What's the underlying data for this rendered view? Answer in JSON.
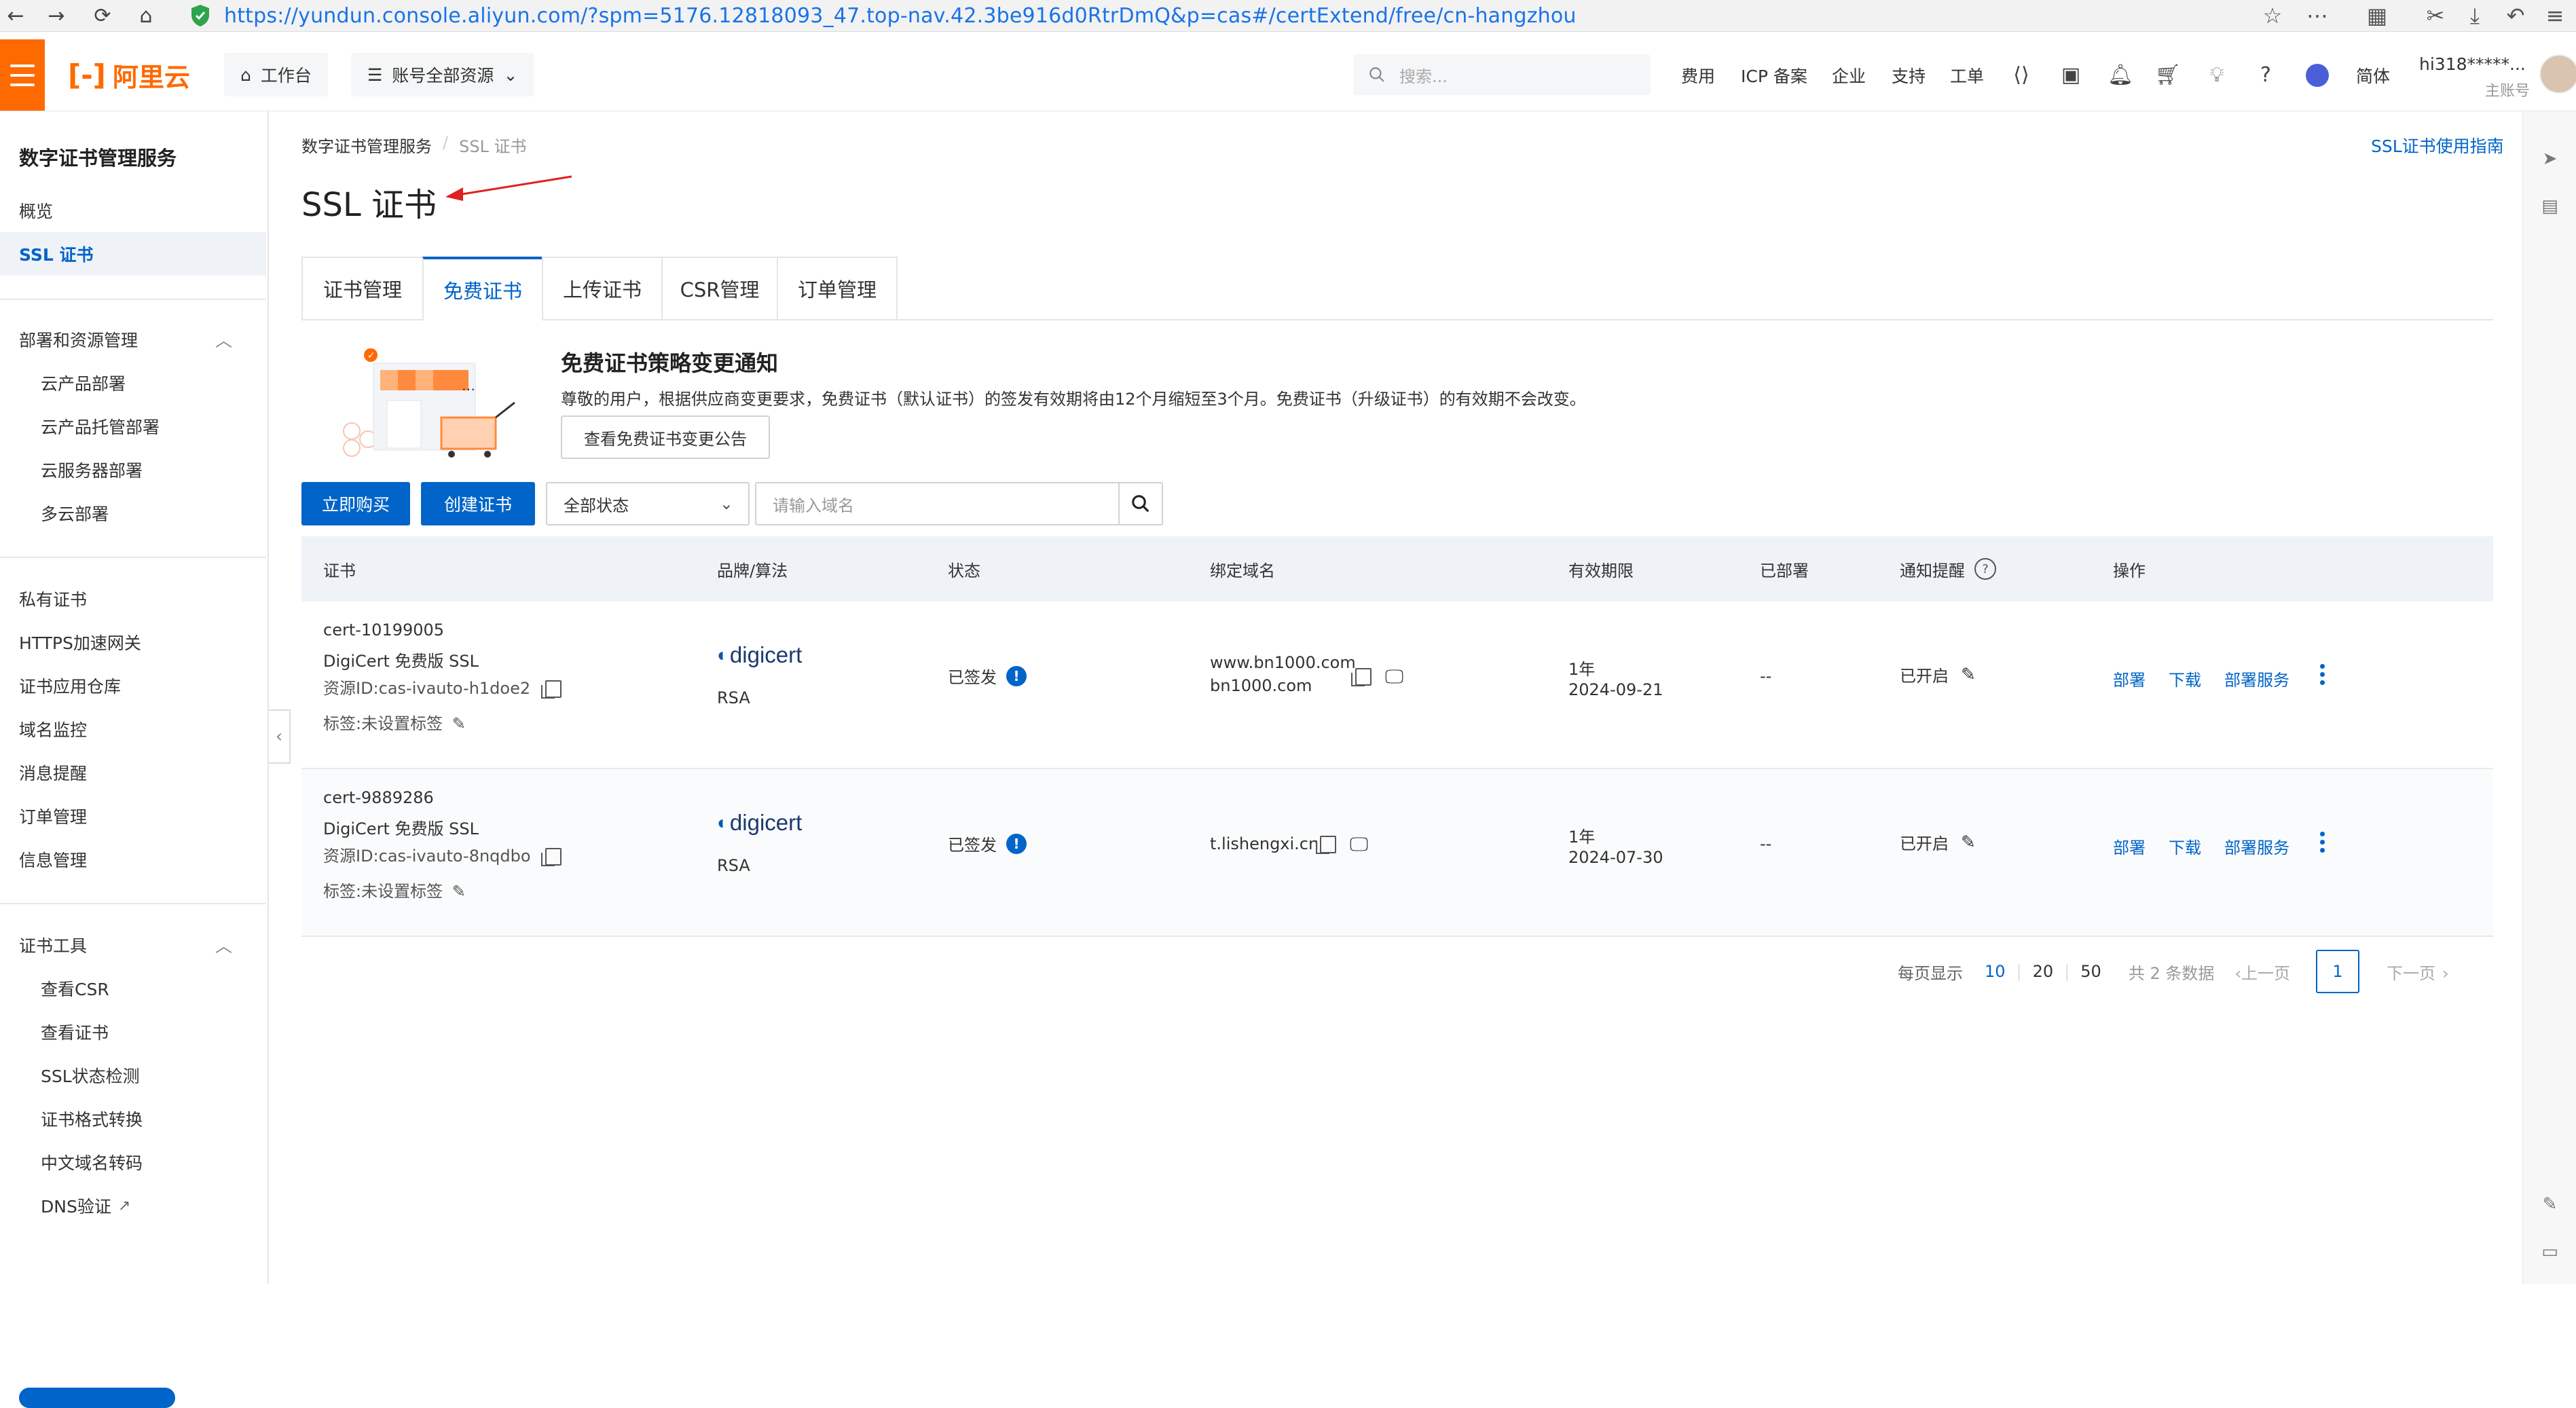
{
  "browser": {
    "url": "https://yundun.console.aliyun.com/?spm=5176.12818093_47.top-nav.42.3be916d0RtrDmQ&p=cas#/certExtend/free/cn-hangzhou"
  },
  "topnav": {
    "logo": "阿里云",
    "workbench": "工作台",
    "resources": "账号全部资源",
    "search_placeholder": "搜索...",
    "links": [
      "费用",
      "ICP 备案",
      "企业",
      "支持",
      "工单"
    ],
    "lang": "简体",
    "user_name": "hi318*****...",
    "user_role": "主账号"
  },
  "sidebar": {
    "title": "数字证书管理服务",
    "top_items": [
      "概览",
      "SSL 证书"
    ],
    "group1": {
      "label": "部署和资源管理",
      "items": [
        "云产品部署",
        "云产品托管部署",
        "云服务器部署",
        "多云部署"
      ]
    },
    "middle_items": [
      "私有证书",
      "HTTPS加速网关",
      "证书应用仓库",
      "域名监控",
      "消息提醒",
      "订单管理",
      "信息管理"
    ],
    "group2": {
      "label": "证书工具",
      "items": [
        "查看CSR",
        "查看证书",
        "SSL状态检测",
        "证书格式转换",
        "中文域名转码",
        "DNS验证"
      ]
    }
  },
  "breadcrumb": {
    "root": "数字证书管理服务",
    "sep": "/",
    "current": "SSL 证书"
  },
  "guide_link": "SSL证书使用指南",
  "page_title": "SSL 证书",
  "tabs": [
    "证书管理",
    "免费证书",
    "上传证书",
    "CSR管理",
    "订单管理"
  ],
  "notice": {
    "title": "免费证书策略变更通知",
    "text": "尊敬的用户，根据供应商变更要求，免费证书（默认证书）的签发有效期将由12个月缩短至3个月。免费证书（升级证书）的有效期不会改变。",
    "button": "查看免费证书变更公告"
  },
  "toolbar": {
    "buy": "立即购买",
    "create": "创建证书",
    "status_select": "全部状态",
    "domain_placeholder": "请输入域名"
  },
  "table": {
    "headers": [
      "证书",
      "品牌/算法",
      "状态",
      "绑定域名",
      "有效期限",
      "已部署",
      "通知提醒",
      "操作"
    ],
    "rows": [
      {
        "name": "cert-10199005",
        "product": "DigiCert 免费版 SSL",
        "resource_id": "资源ID:cas-ivauto-h1doe2",
        "tag": "标签:未设置标签",
        "brand": "digicert",
        "algo": "RSA",
        "status": "已签发",
        "domain1": "www.bn1000.com",
        "domain2": "bn1000.com",
        "validity": "1年",
        "date": "2024-09-21",
        "deployed": "--",
        "notify": "已开启",
        "actions": [
          "部署",
          "下载",
          "部署服务"
        ]
      },
      {
        "name": "cert-9889286",
        "product": "DigiCert 免费版 SSL",
        "resource_id": "资源ID:cas-ivauto-8nqdbo",
        "tag": "标签:未设置标签",
        "brand": "digicert",
        "algo": "RSA",
        "status": "已签发",
        "domain1": "t.lishengxi.cn",
        "domain2": "",
        "validity": "1年",
        "date": "2024-07-30",
        "deployed": "--",
        "notify": "已开启",
        "actions": [
          "部署",
          "下载",
          "部署服务"
        ]
      }
    ]
  },
  "pagination": {
    "per_page_label": "每页显示",
    "sizes": [
      "10",
      "20",
      "50"
    ],
    "total": "共 2 条数据",
    "prev": "上一页",
    "current": "1",
    "next": "下一页"
  },
  "colors": {
    "brand_orange": "#ff6a00",
    "primary_blue": "#0064c8"
  }
}
